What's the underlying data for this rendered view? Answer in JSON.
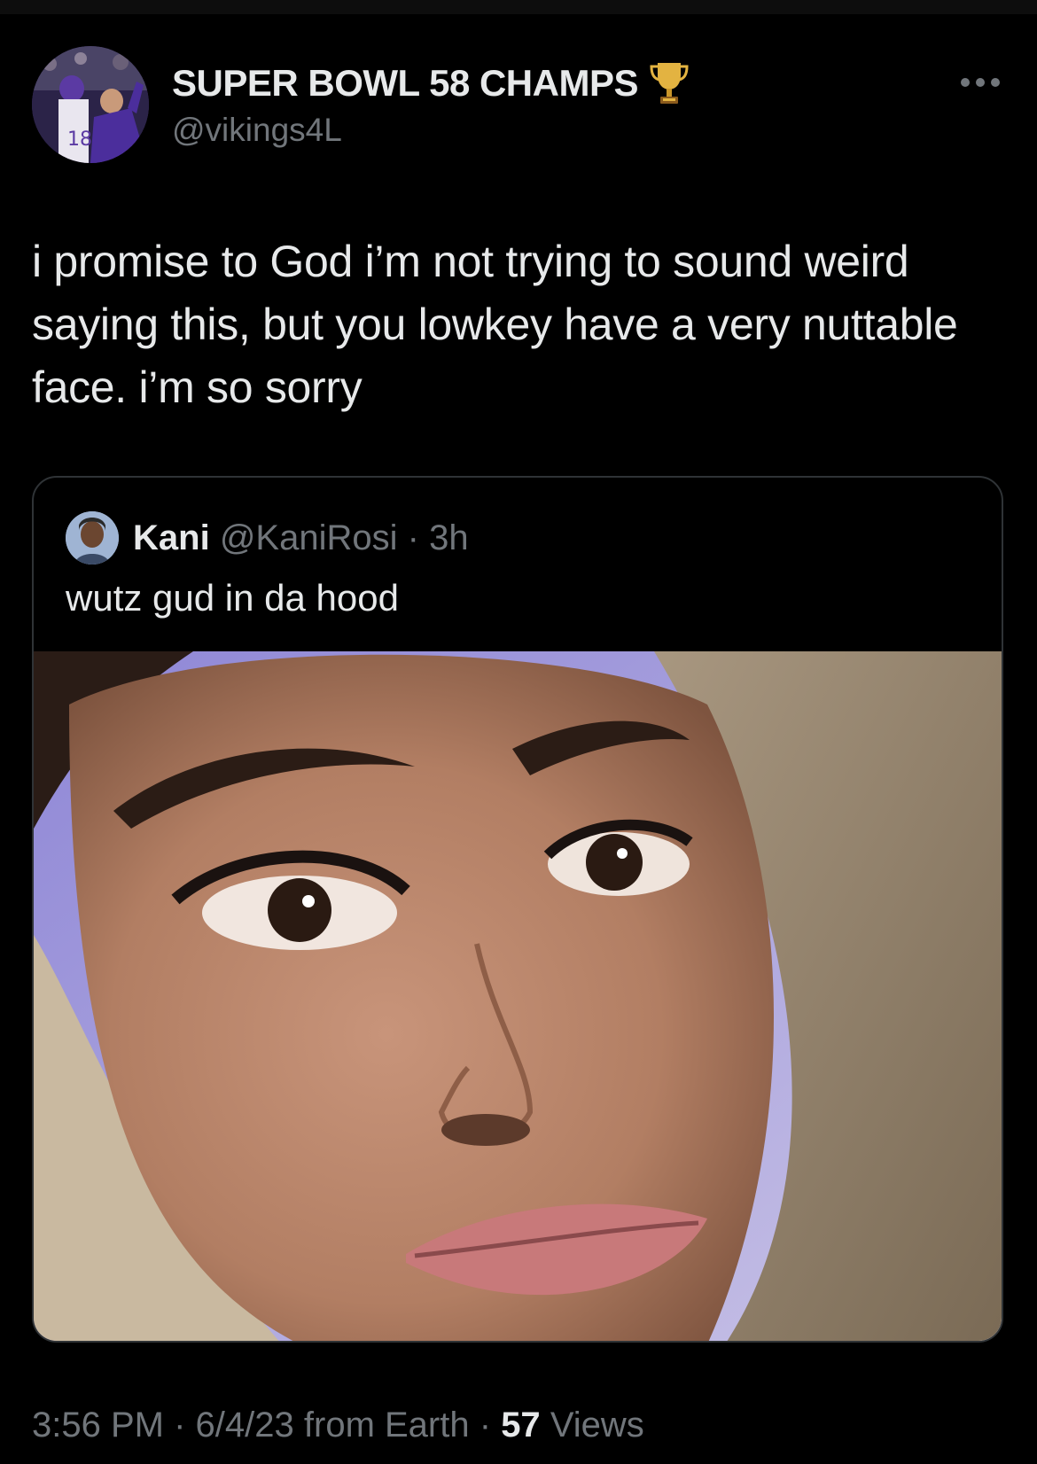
{
  "author": {
    "display_name": "SUPER BOWL 58 CHAMPS",
    "handle": "@vikings4L",
    "badge_icon": "trophy-icon"
  },
  "tweet": {
    "text": "i promise to God i’m not trying to sound weird saying this, but you lowkey have a very nuttable face. i’m so sorry"
  },
  "quoted_tweet": {
    "name": "Kani",
    "handle": "@KaniRosi",
    "separator": "·",
    "time": "3h",
    "text": "wutz gud in da hood"
  },
  "footer": {
    "time": "3:56 PM",
    "sep1": "·",
    "date": "6/4/23",
    "source": "from Earth",
    "sep2": "·",
    "views_count": "57",
    "views_label": "Views"
  },
  "colors": {
    "background": "#000000",
    "primary_text": "#e7e9ea",
    "secondary_text": "#71767b",
    "border": "#2f3336"
  }
}
